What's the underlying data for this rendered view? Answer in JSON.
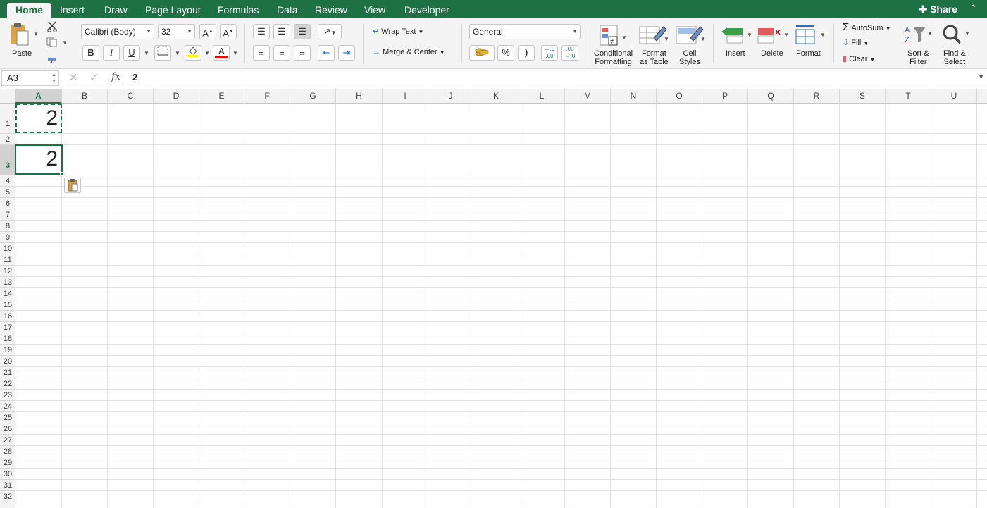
{
  "tabs": [
    "Home",
    "Insert",
    "Draw",
    "Page Layout",
    "Formulas",
    "Data",
    "Review",
    "View",
    "Developer"
  ],
  "share_label": "Share",
  "ribbon": {
    "paste": "Paste",
    "font_name": "Calibri (Body)",
    "font_size": "32",
    "bold": "B",
    "italic": "I",
    "underline": "U",
    "font_color_letter": "A",
    "wrap_text": "Wrap Text",
    "merge_center": "Merge & Center",
    "number_format": "General",
    "percent": "%",
    "comma": ")",
    "cond_format_1": "Conditional",
    "cond_format_2": "Formatting",
    "format_table_1": "Format",
    "format_table_2": "as Table",
    "cell_styles_1": "Cell",
    "cell_styles_2": "Styles",
    "insert": "Insert",
    "delete": "Delete",
    "format": "Format",
    "autosum": "AutoSum",
    "fill": "Fill",
    "clear": "Clear",
    "sort_1": "Sort &",
    "sort_2": "Filter",
    "find_1": "Find &",
    "find_2": "Select"
  },
  "formula_bar": {
    "name_box": "A3",
    "value": "2"
  },
  "columns": [
    "A",
    "B",
    "C",
    "D",
    "E",
    "F",
    "G",
    "H",
    "I",
    "J",
    "K",
    "L",
    "M",
    "N",
    "O",
    "P",
    "Q",
    "R",
    "S",
    "T",
    "U"
  ],
  "rows": [
    "1",
    "2",
    "3",
    "4",
    "5",
    "6",
    "7",
    "8",
    "9",
    "10",
    "11",
    "12",
    "13",
    "14",
    "15",
    "16",
    "17",
    "18",
    "19",
    "20",
    "21",
    "22",
    "23",
    "24",
    "25",
    "26",
    "27",
    "28",
    "29",
    "30",
    "31",
    "32"
  ],
  "cells": {
    "A1": "2",
    "A3": "2"
  },
  "colors": {
    "accent": "#1e7145",
    "highlight_yellow": "#ffff00",
    "font_red": "#ff0000"
  }
}
